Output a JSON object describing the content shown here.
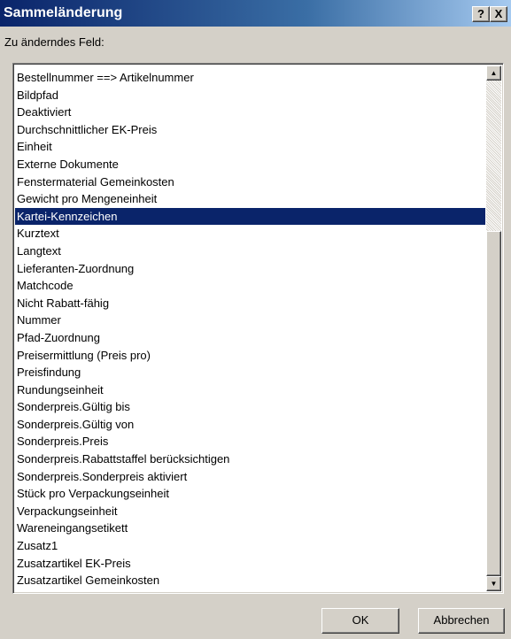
{
  "window": {
    "title": "Sammeländerung",
    "help_label": "?",
    "close_label": "X"
  },
  "field_label": "Zu änderndes Feld:",
  "list": {
    "selected_index": 8,
    "items": [
      "Bestellnummer ==> Artikelnummer",
      "Bildpfad",
      "Deaktiviert",
      "Durchschnittlicher EK-Preis",
      "Einheit",
      "Externe Dokumente",
      "Fenstermaterial Gemeinkosten",
      "Gewicht pro Mengeneinheit",
      "Kartei-Kennzeichen",
      "Kurztext",
      "Langtext",
      "Lieferanten-Zuordnung",
      "Matchcode",
      "Nicht Rabatt-fähig",
      "Nummer",
      "Pfad-Zuordnung",
      "Preisermittlung (Preis pro)",
      "Preisfindung",
      "Rundungseinheit",
      "Sonderpreis.Gültig bis",
      "Sonderpreis.Gültig von",
      "Sonderpreis.Preis",
      "Sonderpreis.Rabattstaffel berücksichtigen",
      "Sonderpreis.Sonderpreis aktiviert",
      "Stück pro Verpackungseinheit",
      "Verpackungseinheit",
      "Wareneingangsetikett",
      "Zusatz1",
      "Zusatzartikel EK-Preis",
      "Zusatzartikel Gemeinkosten"
    ]
  },
  "scrollbar": {
    "up_icon": "arrow-up-icon",
    "down_icon": "arrow-down-icon"
  },
  "buttons": {
    "ok_label": "OK",
    "cancel_label": "Abbrechen"
  },
  "colors": {
    "titlebar_start": "#0a246a",
    "titlebar_end": "#a6caf0",
    "selection": "#0a246a",
    "face": "#d4d0c8"
  }
}
